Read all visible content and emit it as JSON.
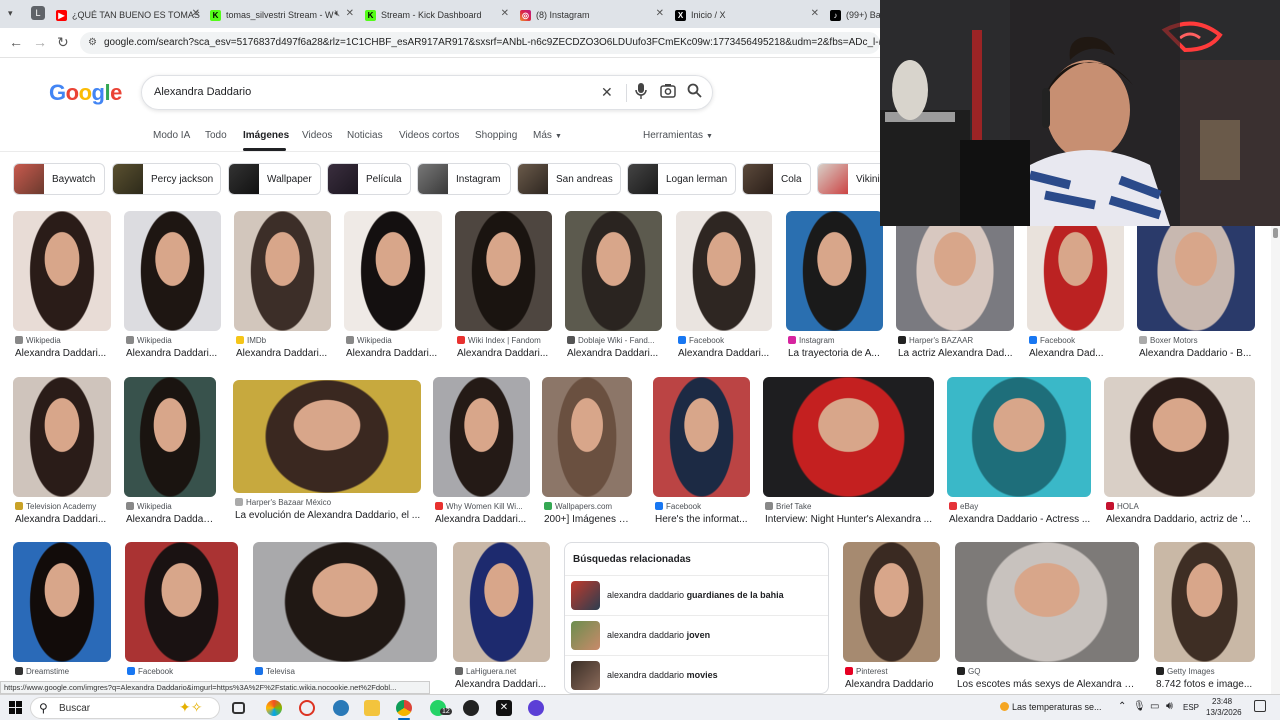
{
  "browser": {
    "tabs": [
      {
        "title": "¿QUÉ TAN BUENO ES TOMAS",
        "color": "#ff0000",
        "glyph": "▶"
      },
      {
        "title": "tomas_silvestri Stream - W",
        "color": "#53fc18",
        "glyph": "K"
      },
      {
        "title": "Stream - Kick Dashboard",
        "color": "#53fc18",
        "glyph": "K"
      },
      {
        "title": "(8) Instagram",
        "color": "#d6249f",
        "glyph": "◎"
      },
      {
        "title": "Inicio / X",
        "color": "#000000",
        "glyph": "X"
      },
      {
        "title": "(99+) Bau",
        "color": "#000000",
        "glyph": "♪"
      }
    ],
    "profile_letter": "L",
    "url": "google.com/search?sca_esv=5176837d497f6a28&rlz=1C1CHBF_esAR917AR917&sxsrf=ANbL-n6c9ZECDZO3O6LDUufo3FCmEKc09w:1773456495218&udm=2&fbs=ADc_l-bpk8W4E-qsVlOvb"
  },
  "google": {
    "logo": {
      "letters": [
        "G",
        "o",
        "o",
        "g",
        "l",
        "e"
      ],
      "colors": [
        "#4285f4",
        "#ea4335",
        "#fbbc05",
        "#4285f4",
        "#34a853",
        "#ea4335"
      ]
    },
    "query": "Alexandra Daddario",
    "tabs": [
      "Modo IA",
      "Todo",
      "Imágenes",
      "Videos",
      "Noticias",
      "Videos cortos",
      "Shopping",
      "Más"
    ],
    "tools_label": "Herramientas",
    "chips": [
      "Baywatch",
      "Percy jackson",
      "Wallpaper",
      "Película",
      "Instagram",
      "San andreas",
      "Logan lerman",
      "Cola",
      "Vikini"
    ],
    "results": [
      {
        "source": "Wikipedia",
        "title": "Alexandra Daddari...",
        "color": "#888888"
      },
      {
        "source": "Wikipedia",
        "title": "Alexandra Daddari...",
        "color": "#888888"
      },
      {
        "source": "IMDb",
        "title": "Alexandra Daddari...",
        "color": "#f5c518"
      },
      {
        "source": "Wikipedia",
        "title": "Alexandra Daddari...",
        "color": "#888888"
      },
      {
        "source": "Wiki Index | Fandom",
        "title": "Alexandra Daddari...",
        "color": "#e8312f"
      },
      {
        "source": "Doblaje Wiki - Fand...",
        "title": "Alexandra Daddari...",
        "color": "#555555"
      },
      {
        "source": "Facebook",
        "title": "Alexandra Daddari...",
        "color": "#1877f2"
      },
      {
        "source": "Instagram",
        "title": "La trayectoria de A...",
        "color": "#d6249f"
      },
      {
        "source": "Harper's BAZAAR",
        "title": "La actriz Alexandra Dad...",
        "color": "#222222"
      },
      {
        "source": "Facebook",
        "title": "Alexandra Dad...",
        "color": "#1877f2"
      },
      {
        "source": "Boxer Motors",
        "title": "Alexandra Daddario - B...",
        "color": "#aaaaaa"
      },
      {
        "source": "Television Academy",
        "title": "Alexandra Daddari...",
        "color": "#c9a227"
      },
      {
        "source": "Wikipedia",
        "title": "Alexandra Daddari...",
        "color": "#888888"
      },
      {
        "source": "Harper's Bazaar México",
        "title": "La evolución de Alexandra Daddario, el ...",
        "color": "#aaaaaa"
      },
      {
        "source": "Why Women Kill Wi...",
        "title": "Alexandra Daddari...",
        "color": "#e8312f"
      },
      {
        "source": "Wallpapers.com",
        "title": "200+] Imágenes d...",
        "color": "#34a853"
      },
      {
        "source": "Facebook",
        "title": "Here's the informat...",
        "color": "#1877f2"
      },
      {
        "source": "Brief Take",
        "title": "Interview: Night Hunter's Alexandra ...",
        "color": "#888888"
      },
      {
        "source": "eBay",
        "title": "Alexandra Daddario - Actress ...",
        "color": "#e53238"
      },
      {
        "source": "HOLA",
        "title": "Alexandra Daddario, actriz de '...",
        "color": "#c4122f"
      },
      {
        "source": "Dreamstime",
        "title": "",
        "color": "#333333"
      },
      {
        "source": "Facebook",
        "title": "",
        "color": "#1877f2"
      },
      {
        "source": "Televisa",
        "title": "",
        "color": "#1a73e8"
      },
      {
        "source": "LaHiguera.net",
        "title": "Alexandra Daddari...",
        "color": "#666666"
      },
      {
        "source": "Pinterest",
        "title": "Alexandra Daddario",
        "color": "#e60023"
      },
      {
        "source": "GQ",
        "title": "Los escotes más sexys de Alexandra D...",
        "color": "#222222"
      },
      {
        "source": "Getty Images",
        "title": "8.742 fotos e image...",
        "color": "#222222"
      }
    ],
    "related": {
      "heading": "Búsquedas relacionadas",
      "items": [
        {
          "prefix": "alexandra daddario ",
          "bold": "guardianes de la bahia"
        },
        {
          "prefix": "alexandra daddario ",
          "bold": "joven"
        },
        {
          "prefix": "alexandra daddario ",
          "bold": "movies"
        }
      ]
    }
  },
  "status_url": "https://www.google.com/imgres?q=Alexandra Daddario&imgurl=https%3A%2F%2Fstatic.wikia.nocookie.net%2Fdobl...",
  "taskbar": {
    "search_label": "Buscar",
    "weather": "Las temperaturas se...",
    "lang": "ESP",
    "time": "23:48",
    "date": "13/3/2026",
    "badge": "12"
  }
}
